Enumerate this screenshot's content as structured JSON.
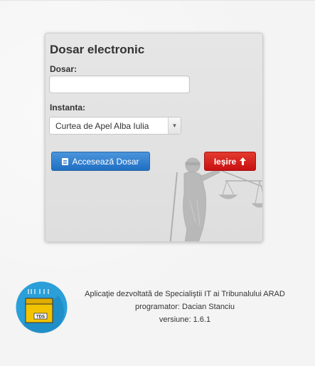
{
  "form": {
    "title": "Dosar electronic",
    "dosar_label": "Dosar:",
    "dosar_value": "",
    "instanta_label": "Instanta:",
    "instanta_selected": "Curtea de Apel Alba Iulia"
  },
  "buttons": {
    "acceseaza_label": "Accesează Dosar",
    "iesire_label": "Ieşire"
  },
  "footer": {
    "line1": "Aplicaţie dezvoltată de Specialiştii IT ai Tribunalului ARAD",
    "line2": "programator: Dacian Stanciu",
    "line3": "versiune: 1.6.1",
    "logo_text": "TDS"
  },
  "icons": {
    "acceseaza_icon": "document-icon",
    "iesire_icon": "arrow-up-icon",
    "select_icon": "caret-down-icon"
  },
  "colors": {
    "primary": "#1f6ec2",
    "danger": "#c81010",
    "logo_bg": "#2a9fd8",
    "logo_accent": "#f2c300"
  }
}
